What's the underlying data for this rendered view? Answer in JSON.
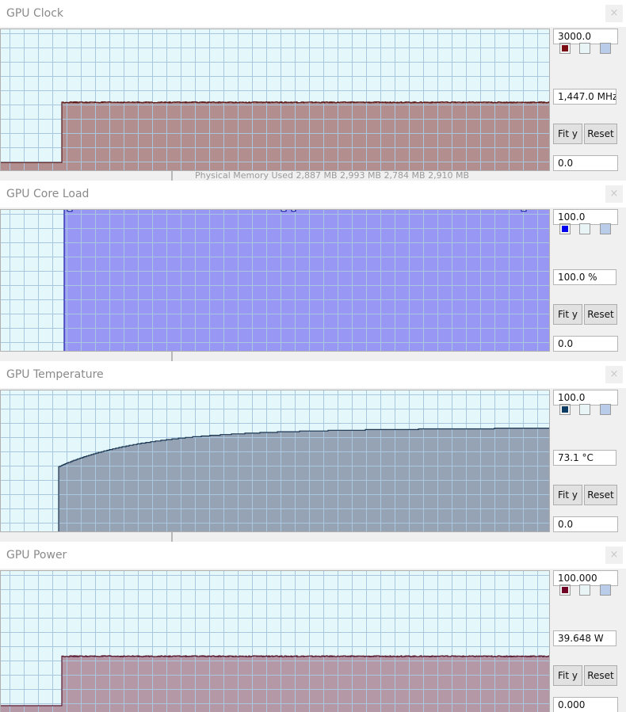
{
  "panels": [
    {
      "title": "GPU Clock",
      "close_label": "×",
      "max_value": "3000.0",
      "current_value": "1,447.0 MHz",
      "min_value": "0.0",
      "fit_label": "Fit y",
      "reset_label": "Reset",
      "series_color": "#7a0d14",
      "fill_color": "#b28e8e",
      "line_color": "#5a1a1a",
      "strip_text": "Physical Memory Used    2,887 MB    2,993 MB    2,784 MB    2,910 MB",
      "chart_data": {
        "type": "area",
        "ylim": [
          0,
          3000
        ],
        "start_fraction": 0.113,
        "idle_value": 180,
        "level": 1447,
        "ramp": false,
        "noise": 10,
        "dips": []
      }
    },
    {
      "title": "GPU Core Load",
      "close_label": "×",
      "max_value": "100.0",
      "current_value": "100.0 %",
      "min_value": "0.0",
      "fit_label": "Fit y",
      "reset_label": "Reset",
      "series_color": "#0000ee",
      "fill_color": "#9898f4",
      "line_color": "#1a1aa0",
      "strip_text": "",
      "chart_data": {
        "type": "area",
        "ylim": [
          0,
          100
        ],
        "start_fraction": 0.116,
        "idle_value": 0,
        "level": 100,
        "ramp": false,
        "noise": 0,
        "dips": [
          0.126,
          0.515,
          0.533,
          0.952
        ]
      }
    },
    {
      "title": "GPU Temperature",
      "close_label": "×",
      "max_value": "100.0",
      "current_value": "73.1 °C",
      "min_value": "0.0",
      "fit_label": "Fit y",
      "reset_label": "Reset",
      "series_color": "#0b3a63",
      "fill_color": "#95a3b4",
      "line_color": "#1a3550",
      "strip_text": "",
      "chart_data": {
        "type": "area",
        "ylim": [
          0,
          100
        ],
        "start_fraction": 0.107,
        "idle_value": 0,
        "level": 73.1,
        "ramp": true,
        "ramp_start": 48,
        "noise": 0,
        "dips": []
      }
    },
    {
      "title": "GPU Power",
      "close_label": "×",
      "max_value": "100.000",
      "current_value": "39.648 W",
      "min_value": "0.000",
      "fit_label": "Fit y",
      "reset_label": "Reset",
      "series_color": "#700024",
      "fill_color": "#b498a6",
      "line_color": "#5a1a30",
      "strip_text": "",
      "chart_data": {
        "type": "area",
        "ylim": [
          0,
          100
        ],
        "start_fraction": 0.113,
        "idle_value": 5,
        "level": 39.648,
        "ramp": false,
        "noise": 0.35,
        "dips": []
      }
    }
  ]
}
